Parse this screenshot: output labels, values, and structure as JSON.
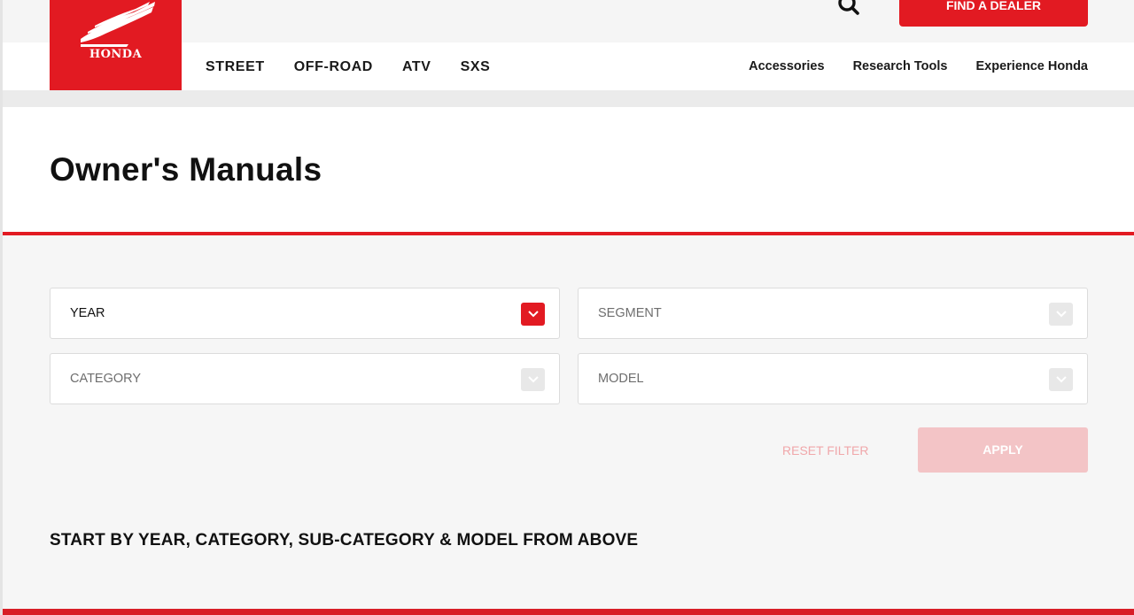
{
  "brand": {
    "logo_text": "HONDA",
    "color": "#e21a22"
  },
  "header": {
    "find_dealer_label": "FIND A DEALER",
    "main_nav": [
      "STREET",
      "OFF-ROAD",
      "ATV",
      "SXS"
    ],
    "utility_nav": [
      "Accessories",
      "Research Tools",
      "Experience Honda"
    ],
    "search_icon": "search-icon"
  },
  "page": {
    "title": "Owner's Manuals"
  },
  "filters": {
    "year": {
      "label": "YEAR",
      "enabled": true
    },
    "segment": {
      "label": "SEGMENT",
      "enabled": false
    },
    "category": {
      "label": "CATEGORY",
      "enabled": false
    },
    "model": {
      "label": "MODEL",
      "enabled": false
    },
    "reset_label": "RESET FILTER",
    "apply_label": "APPLY"
  },
  "hint_text": "START BY YEAR, CATEGORY, SUB-CATEGORY & MODEL FROM ABOVE"
}
